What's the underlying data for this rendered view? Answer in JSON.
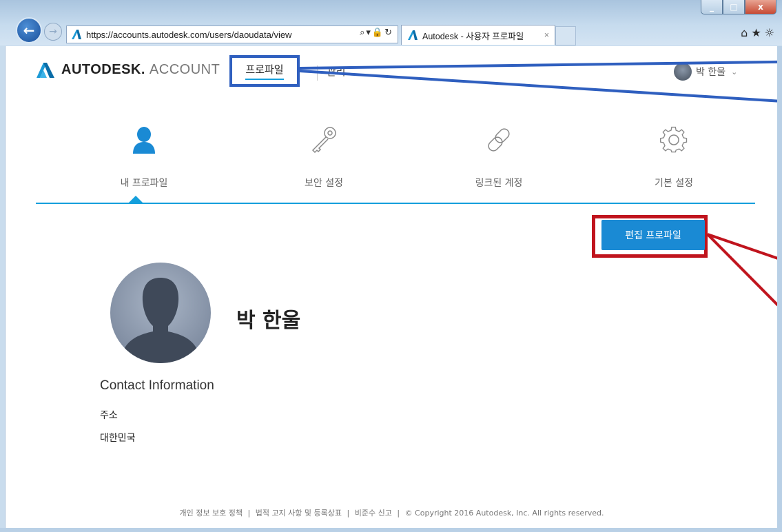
{
  "browser": {
    "url": "https://accounts.autodesk.com/users/daoudata/view",
    "tab_title": "Autodesk - 사용자 프로파일",
    "tab_close": "×",
    "minimize": "_",
    "maximize": "□",
    "close": "x"
  },
  "header": {
    "brand": "AUTODESK.",
    "brand_sub": "ACCOUNT",
    "nav_profile": "프로파일",
    "nav_manage": "관리",
    "user_name": "박 한울",
    "user_caret": "⌄"
  },
  "tabs": [
    {
      "label": "내 프로파일",
      "icon": "user-icon"
    },
    {
      "label": "보안 설정",
      "icon": "key-icon"
    },
    {
      "label": "링크된 계정",
      "icon": "link-icon"
    },
    {
      "label": "기본 설정",
      "icon": "gear-icon"
    }
  ],
  "profile": {
    "edit_button": "편집 프로파일",
    "name": "박 한울",
    "contact_title": "Contact Information",
    "address_label": "주소",
    "address_value": "대한민국"
  },
  "footer": {
    "privacy": "개인 정보 보호 정책",
    "legal": "법적 고지 사항 및 등록상표",
    "compliance": "비준수 신고",
    "copyright": "© Copyright 2016 Autodesk, Inc. All rights reserved.",
    "sep": "|"
  },
  "annotation_colors": {
    "highlight_blue": "#2f5fbf",
    "highlight_red": "#c0141d",
    "accent": "#149fdc",
    "button": "#1a8ad4"
  }
}
